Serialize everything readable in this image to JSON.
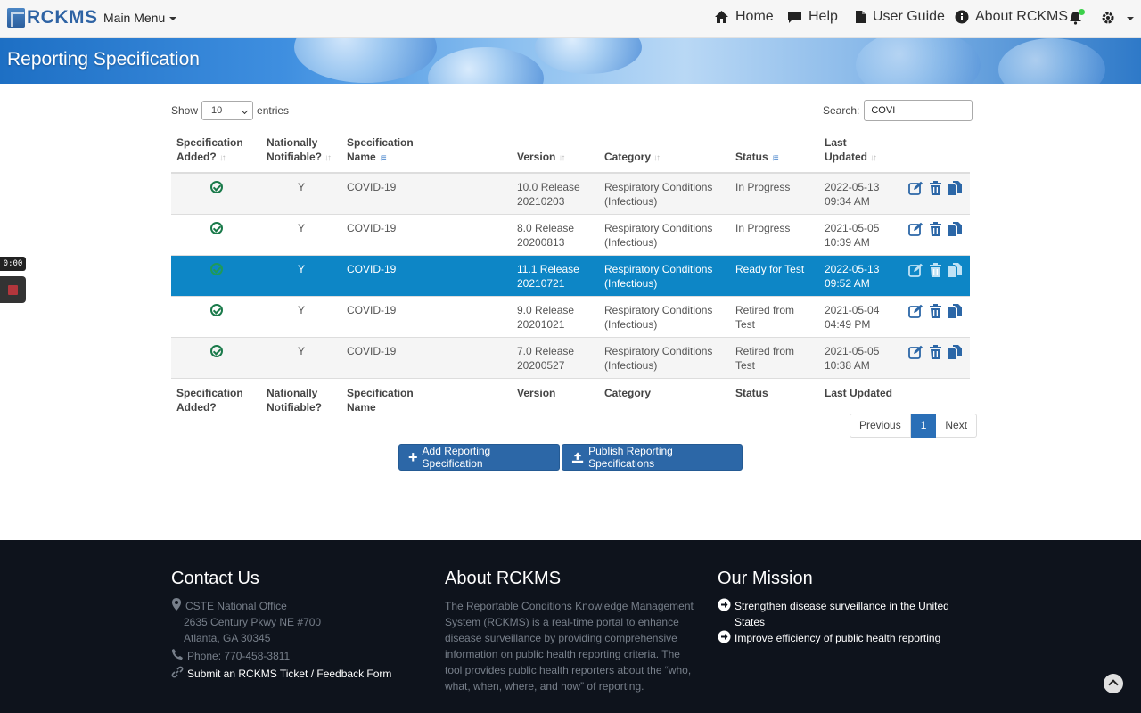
{
  "nav": {
    "logo": "RCKMS",
    "main_menu": "Main Menu",
    "home": "Home",
    "help": "Help",
    "user_guide": "User Guide",
    "about": "About RCKMS"
  },
  "banner": {
    "title": "Reporting Specification"
  },
  "table_controls": {
    "show_label": "Show",
    "entries_label": "entries",
    "page_size": "10",
    "search_label": "Search:",
    "search_value": "COVI"
  },
  "table": {
    "headers": {
      "added": [
        "Specification",
        "Added?"
      ],
      "notifiable": [
        "Nationally",
        "Notifiable?"
      ],
      "name": [
        "Specification",
        "Name"
      ],
      "version": "Version",
      "category": "Category",
      "status": "Status",
      "updated": [
        "Last",
        "Updated"
      ]
    },
    "footer_headers": {
      "added": [
        "Specification",
        "Added?"
      ],
      "notifiable": [
        "Nationally",
        "Notifiable?"
      ],
      "name": [
        "Specification",
        "Name"
      ],
      "version": "Version",
      "category": "Category",
      "status": "Status",
      "updated": "Last Updated"
    },
    "rows": [
      {
        "added": true,
        "notifiable": "Y",
        "name": "COVID-19",
        "version": [
          "10.0 Release",
          "20210203"
        ],
        "category": [
          "Respiratory Conditions",
          "(Infectious)"
        ],
        "status": [
          "In Progress",
          ""
        ],
        "updated": [
          "2022-05-13",
          "09:34 AM"
        ],
        "selected": false
      },
      {
        "added": true,
        "notifiable": "Y",
        "name": "COVID-19",
        "version": [
          "8.0 Release",
          "20200813"
        ],
        "category": [
          "Respiratory Conditions",
          "(Infectious)"
        ],
        "status": [
          "In Progress",
          ""
        ],
        "updated": [
          "2021-05-05",
          "10:39 AM"
        ],
        "selected": false
      },
      {
        "added": true,
        "notifiable": "Y",
        "name": "COVID-19",
        "version": [
          "11.1 Release",
          "20210721"
        ],
        "category": [
          "Respiratory Conditions",
          "(Infectious)"
        ],
        "status": [
          "Ready for Test",
          ""
        ],
        "updated": [
          "2022-05-13",
          "09:52 AM"
        ],
        "selected": true
      },
      {
        "added": true,
        "notifiable": "Y",
        "name": "COVID-19",
        "version": [
          "9.0 Release",
          "20201021"
        ],
        "category": [
          "Respiratory Conditions",
          "(Infectious)"
        ],
        "status": [
          "Retired from",
          "Test"
        ],
        "updated": [
          "2021-05-04",
          "04:49 PM"
        ],
        "selected": false
      },
      {
        "added": true,
        "notifiable": "Y",
        "name": "COVID-19",
        "version": [
          "7.0 Release",
          "20200527"
        ],
        "category": [
          "Respiratory Conditions",
          "(Infectious)"
        ],
        "status": [
          "Retired from",
          "Test"
        ],
        "updated": [
          "2021-05-05",
          "10:38 AM"
        ],
        "selected": false
      }
    ]
  },
  "pagination": {
    "previous": "Previous",
    "current": "1",
    "next": "Next"
  },
  "buttons": {
    "add": "Add Reporting Specification",
    "publish": "Publish Reporting Specifications"
  },
  "recorder": {
    "time": "0:00"
  },
  "footer": {
    "contact_title": "Contact Us",
    "office": "CSTE National Office",
    "address1": "2635 Century Pkwy NE #700",
    "address2": "Atlanta, GA 30345",
    "phone": "Phone: 770-458-3811",
    "ticket_link": "Submit an RCKMS Ticket / Feedback Form",
    "about_title": "About RCKMS",
    "about_text": "The Reportable Conditions Knowledge Management System (RCKMS) is a real-time portal to enhance disease surveillance by providing comprehensive information on public health reporting criteria. The tool provides public health reporters about the “who, what, when, where, and how” of reporting.",
    "mission_title": "Our Mission",
    "mission1": "Strengthen disease surveillance in the United States",
    "mission2": "Improve efficiency of public health reporting"
  },
  "colors": {
    "brand": "#2c67a7",
    "selected_row": "#0d86c6",
    "check_green": "#1a7a4a",
    "footer_bg": "#0e131c"
  }
}
